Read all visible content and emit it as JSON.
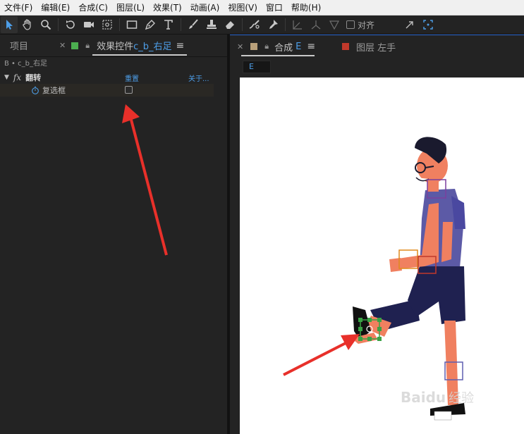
{
  "menu": [
    "文件(F)",
    "编辑(E)",
    "合成(C)",
    "图层(L)",
    "效果(T)",
    "动画(A)",
    "视图(V)",
    "窗口",
    "帮助(H)"
  ],
  "toolbar": {
    "tools": [
      "selection-tool",
      "hand-tool",
      "zoom-tool",
      "rotate-tool",
      "camera-tool",
      "pan-behind-tool",
      "rectangle-tool",
      "pen-tool",
      "type-tool",
      "brush-tool",
      "clone-stamp-tool",
      "eraser-tool",
      "roto-brush-tool",
      "puppet-tool"
    ],
    "snap_label": "对齐"
  },
  "left_panel": {
    "project_tab": "项目",
    "effects_tab_label": "效果控件",
    "effects_tab_layer": "c_b_右足",
    "effects_swatch": "#4caf50",
    "breadcrumb": "B • c_b_右足",
    "effect": {
      "name": "翻转",
      "reset": "重置",
      "about": "关于...",
      "property": "复选框",
      "checked": false
    }
  },
  "right_panel": {
    "comp_tab_label": "合成",
    "comp_tab_name": "E",
    "comp_swatch": "#b8a07a",
    "layer_tab": "图层 左手",
    "layer_swatch": "#c0392b",
    "comp_chip": "E"
  },
  "watermark": {
    "brand": "Baidu",
    "text": "经验"
  },
  "colors": {
    "accent": "#4d9ee8",
    "annotation_arrow": "#e8302a"
  }
}
